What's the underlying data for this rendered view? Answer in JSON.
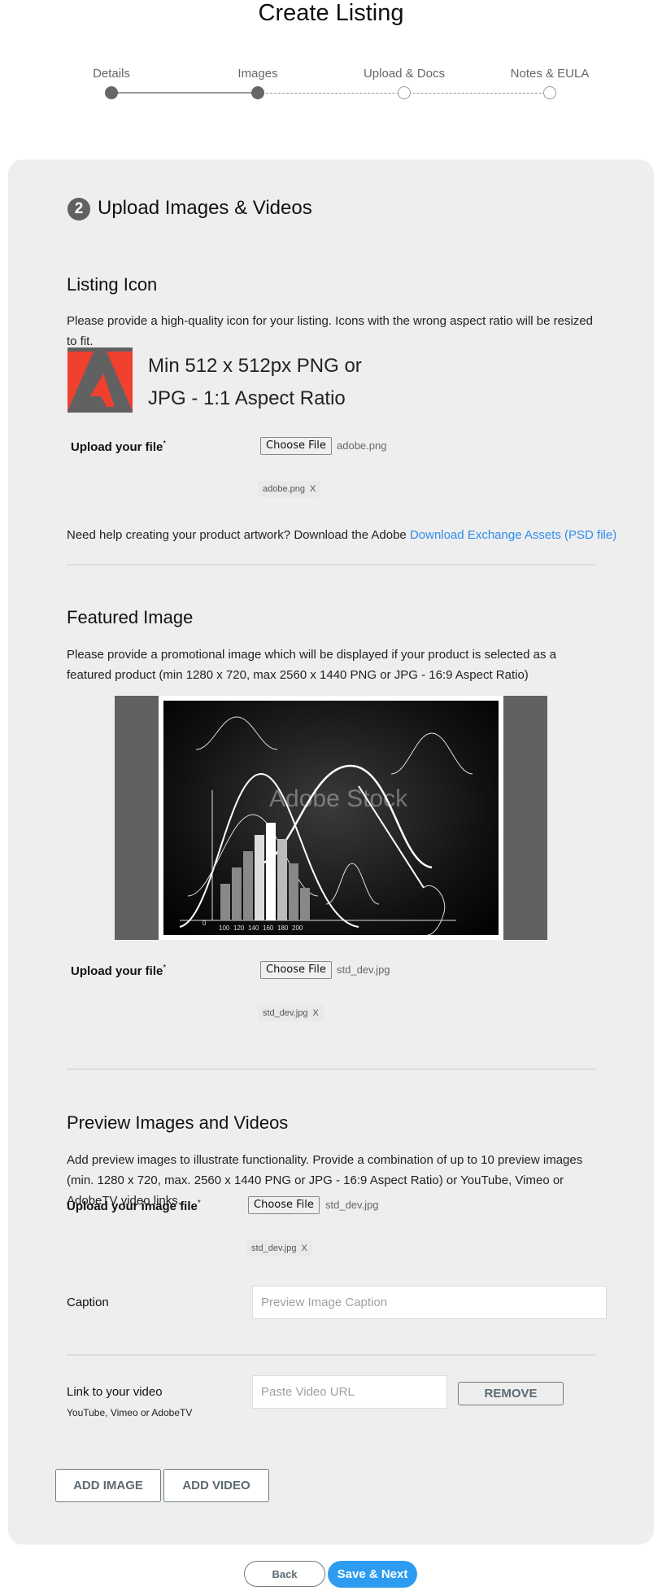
{
  "page": {
    "title": "Create Listing"
  },
  "stepper": {
    "steps": [
      {
        "label": "Details",
        "state": "complete"
      },
      {
        "label": "Images",
        "state": "current"
      },
      {
        "label": "Upload & Docs",
        "state": "pending"
      },
      {
        "label": "Notes & EULA",
        "state": "pending"
      }
    ]
  },
  "section": {
    "number": "2",
    "title": "Upload Images & Videos"
  },
  "listing_icon": {
    "heading": "Listing Icon",
    "description": "Please provide a high-quality icon for your listing. Icons with the wrong aspect ratio will be resized to fit.",
    "requirement_line1": "Min 512 x 512px PNG or",
    "requirement_line2": "JPG - 1:1 Aspect Ratio",
    "upload_label": "Upload your file",
    "required_mark": "*",
    "choose_file_label": "Choose File",
    "selected_file": "adobe.png",
    "chip_file": "adobe.png",
    "chip_remove": "X",
    "help_text": "Need help creating your product artwork? Download the Adobe ",
    "help_link": "Download Exchange Assets (PSD file)",
    "colors": {
      "brand_red": "#f0402e",
      "brand_gray": "#616161"
    }
  },
  "featured_image": {
    "heading": "Featured Image",
    "description": "Please provide a promotional image which will be displayed if your product is selected as a featured product (min 1280 x 720, max 2560 x 1440 PNG or JPG - 16:9 Aspect Ratio)",
    "watermark": "Adobe Stock",
    "upload_label": "Upload your file",
    "required_mark": "*",
    "choose_file_label": "Choose File",
    "selected_file": "std_dev.jpg",
    "chip_file": "std_dev.jpg",
    "chip_remove": "X"
  },
  "preview": {
    "heading": "Preview Images and Videos",
    "description": "Add preview images to illustrate functionality. Provide a combination of up to 10 preview images (min. 1280 x 720, max. 2560 x 1440 PNG or JPG - 16:9 Aspect Ratio) or YouTube, Vimeo or AdobeTV video links.",
    "upload_label": "Upload your image file",
    "required_mark": "*",
    "choose_file_label": "Choose File",
    "selected_file": "std_dev.jpg",
    "chip_file": "std_dev.jpg",
    "chip_remove": "X",
    "caption_label": "Caption",
    "caption_placeholder": "Preview Image Caption",
    "caption_value": "",
    "video_label": "Link to your video",
    "video_sublabel": "YouTube, Vimeo or AdobeTV",
    "video_placeholder": "Paste Video URL",
    "video_value": "",
    "remove_label": "REMOVE",
    "add_image_label": "ADD IMAGE",
    "add_video_label": "ADD VIDEO"
  },
  "footer": {
    "back_label": "Back",
    "next_label": "Save & Next",
    "accent_color": "#2d9cf0"
  }
}
